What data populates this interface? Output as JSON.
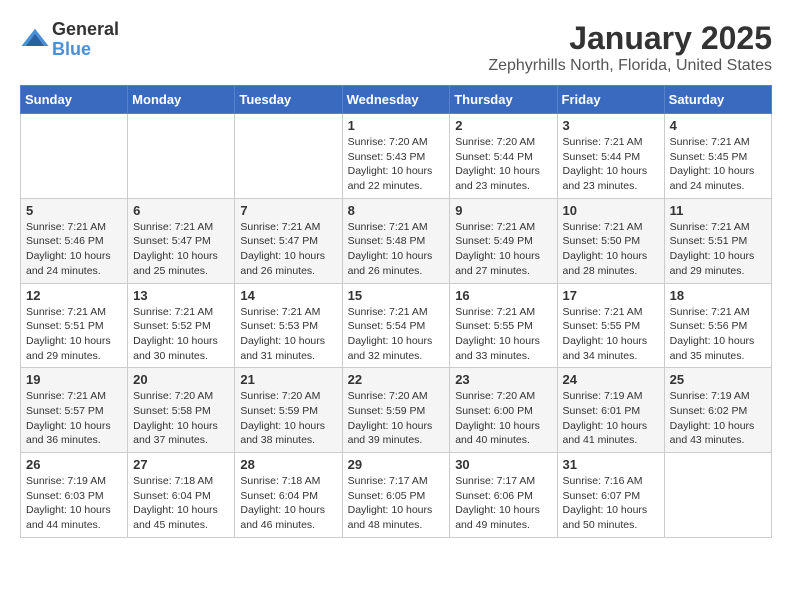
{
  "logo": {
    "general": "General",
    "blue": "Blue"
  },
  "title": "January 2025",
  "location": "Zephyrhills North, Florida, United States",
  "weekdays": [
    "Sunday",
    "Monday",
    "Tuesday",
    "Wednesday",
    "Thursday",
    "Friday",
    "Saturday"
  ],
  "weeks": [
    [
      {
        "day": "",
        "info": ""
      },
      {
        "day": "",
        "info": ""
      },
      {
        "day": "",
        "info": ""
      },
      {
        "day": "1",
        "info": "Sunrise: 7:20 AM\nSunset: 5:43 PM\nDaylight: 10 hours\nand 22 minutes."
      },
      {
        "day": "2",
        "info": "Sunrise: 7:20 AM\nSunset: 5:44 PM\nDaylight: 10 hours\nand 23 minutes."
      },
      {
        "day": "3",
        "info": "Sunrise: 7:21 AM\nSunset: 5:44 PM\nDaylight: 10 hours\nand 23 minutes."
      },
      {
        "day": "4",
        "info": "Sunrise: 7:21 AM\nSunset: 5:45 PM\nDaylight: 10 hours\nand 24 minutes."
      }
    ],
    [
      {
        "day": "5",
        "info": "Sunrise: 7:21 AM\nSunset: 5:46 PM\nDaylight: 10 hours\nand 24 minutes."
      },
      {
        "day": "6",
        "info": "Sunrise: 7:21 AM\nSunset: 5:47 PM\nDaylight: 10 hours\nand 25 minutes."
      },
      {
        "day": "7",
        "info": "Sunrise: 7:21 AM\nSunset: 5:47 PM\nDaylight: 10 hours\nand 26 minutes."
      },
      {
        "day": "8",
        "info": "Sunrise: 7:21 AM\nSunset: 5:48 PM\nDaylight: 10 hours\nand 26 minutes."
      },
      {
        "day": "9",
        "info": "Sunrise: 7:21 AM\nSunset: 5:49 PM\nDaylight: 10 hours\nand 27 minutes."
      },
      {
        "day": "10",
        "info": "Sunrise: 7:21 AM\nSunset: 5:50 PM\nDaylight: 10 hours\nand 28 minutes."
      },
      {
        "day": "11",
        "info": "Sunrise: 7:21 AM\nSunset: 5:51 PM\nDaylight: 10 hours\nand 29 minutes."
      }
    ],
    [
      {
        "day": "12",
        "info": "Sunrise: 7:21 AM\nSunset: 5:51 PM\nDaylight: 10 hours\nand 29 minutes."
      },
      {
        "day": "13",
        "info": "Sunrise: 7:21 AM\nSunset: 5:52 PM\nDaylight: 10 hours\nand 30 minutes."
      },
      {
        "day": "14",
        "info": "Sunrise: 7:21 AM\nSunset: 5:53 PM\nDaylight: 10 hours\nand 31 minutes."
      },
      {
        "day": "15",
        "info": "Sunrise: 7:21 AM\nSunset: 5:54 PM\nDaylight: 10 hours\nand 32 minutes."
      },
      {
        "day": "16",
        "info": "Sunrise: 7:21 AM\nSunset: 5:55 PM\nDaylight: 10 hours\nand 33 minutes."
      },
      {
        "day": "17",
        "info": "Sunrise: 7:21 AM\nSunset: 5:55 PM\nDaylight: 10 hours\nand 34 minutes."
      },
      {
        "day": "18",
        "info": "Sunrise: 7:21 AM\nSunset: 5:56 PM\nDaylight: 10 hours\nand 35 minutes."
      }
    ],
    [
      {
        "day": "19",
        "info": "Sunrise: 7:21 AM\nSunset: 5:57 PM\nDaylight: 10 hours\nand 36 minutes."
      },
      {
        "day": "20",
        "info": "Sunrise: 7:20 AM\nSunset: 5:58 PM\nDaylight: 10 hours\nand 37 minutes."
      },
      {
        "day": "21",
        "info": "Sunrise: 7:20 AM\nSunset: 5:59 PM\nDaylight: 10 hours\nand 38 minutes."
      },
      {
        "day": "22",
        "info": "Sunrise: 7:20 AM\nSunset: 5:59 PM\nDaylight: 10 hours\nand 39 minutes."
      },
      {
        "day": "23",
        "info": "Sunrise: 7:20 AM\nSunset: 6:00 PM\nDaylight: 10 hours\nand 40 minutes."
      },
      {
        "day": "24",
        "info": "Sunrise: 7:19 AM\nSunset: 6:01 PM\nDaylight: 10 hours\nand 41 minutes."
      },
      {
        "day": "25",
        "info": "Sunrise: 7:19 AM\nSunset: 6:02 PM\nDaylight: 10 hours\nand 43 minutes."
      }
    ],
    [
      {
        "day": "26",
        "info": "Sunrise: 7:19 AM\nSunset: 6:03 PM\nDaylight: 10 hours\nand 44 minutes."
      },
      {
        "day": "27",
        "info": "Sunrise: 7:18 AM\nSunset: 6:04 PM\nDaylight: 10 hours\nand 45 minutes."
      },
      {
        "day": "28",
        "info": "Sunrise: 7:18 AM\nSunset: 6:04 PM\nDaylight: 10 hours\nand 46 minutes."
      },
      {
        "day": "29",
        "info": "Sunrise: 7:17 AM\nSunset: 6:05 PM\nDaylight: 10 hours\nand 48 minutes."
      },
      {
        "day": "30",
        "info": "Sunrise: 7:17 AM\nSunset: 6:06 PM\nDaylight: 10 hours\nand 49 minutes."
      },
      {
        "day": "31",
        "info": "Sunrise: 7:16 AM\nSunset: 6:07 PM\nDaylight: 10 hours\nand 50 minutes."
      },
      {
        "day": "",
        "info": ""
      }
    ]
  ]
}
